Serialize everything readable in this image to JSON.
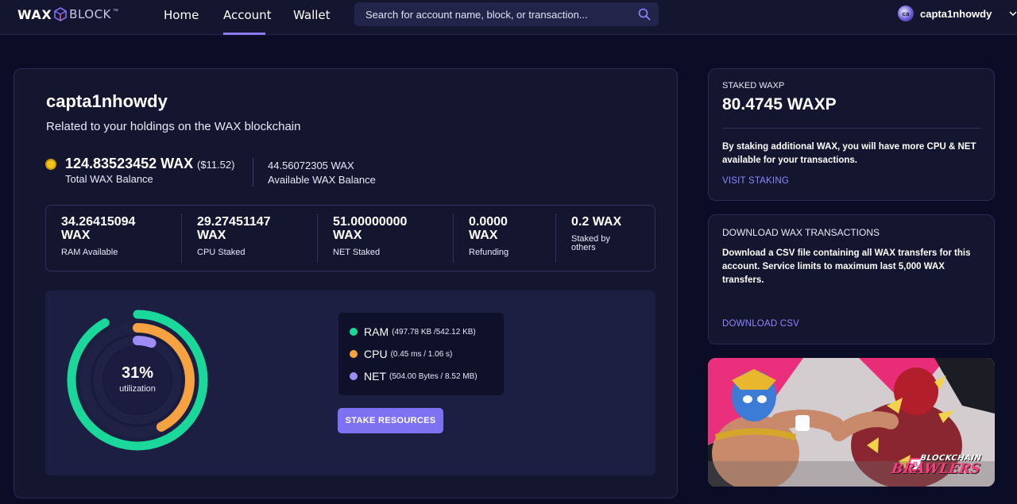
{
  "header": {
    "logo": {
      "part1": "WAX",
      "part2": "BLOCK",
      "tm": "™"
    },
    "nav": [
      {
        "label": "Home"
      },
      {
        "label": "Account"
      },
      {
        "label": "Wallet"
      }
    ],
    "search": {
      "placeholder": "Search for account name, block, or transaction..."
    },
    "user": {
      "avatar_initials": "ca",
      "name": "capta1nhowdy"
    }
  },
  "account": {
    "name": "capta1nhowdy",
    "subtitle": "Related to your holdings on the WAX blockchain",
    "total_amount": "124.83523452 WAX",
    "total_usd": "($11.52)",
    "total_label": "Total WAX Balance",
    "available_amount": "44.56072305 WAX",
    "available_label": "Available WAX Balance"
  },
  "stats": [
    {
      "value": "34.26415094 WAX",
      "label": "RAM Available"
    },
    {
      "value": "29.27451147 WAX",
      "label": "CPU Staked"
    },
    {
      "value": "51.00000000 WAX",
      "label": "NET Staked"
    },
    {
      "value": "0.0000 WAX",
      "label": "Refunding"
    },
    {
      "value": "0.2 WAX",
      "label": "Staked by others"
    }
  ],
  "utilization": {
    "percent_label": "31%",
    "caption": "utilization",
    "ram_fraction": 0.918,
    "cpu_fraction": 0.425,
    "net_fraction": 0.057,
    "legend": [
      {
        "name": "RAM",
        "detail": "(497.78 KB /542.12 KB)",
        "color": "#19d89a"
      },
      {
        "name": "CPU",
        "detail": "(0.45 ms / 1.06 s)",
        "color": "#f7a240"
      },
      {
        "name": "NET",
        "detail": "(504.00 Bytes / 8.52 MB)",
        "color": "#a08cf5"
      }
    ],
    "stake_button": "STAKE RESOURCES"
  },
  "staked_card": {
    "kicker": "STAKED WAXP",
    "amount": "80.4745 WAXP",
    "text": "By staking additional WAX, you will have more CPU & NET available for your transactions.",
    "link": "VISIT STAKING"
  },
  "download_card": {
    "kicker": "DOWNLOAD WAX TRANSACTIONS",
    "text": "Download a CSV file containing all WAX transfers for this account. Service limits to maximum last 5,000 WAX transfers.",
    "link": "DOWNLOAD CSV"
  },
  "promo": {
    "line1": "BLOCKCHAIN",
    "line2": "BRAWLERS",
    "badge": "B"
  },
  "colors": {
    "background": "#0b0c26",
    "card": "#14152f",
    "accent": "#7f72f2",
    "ram": "#19d89a",
    "cpu": "#f7a240",
    "net": "#a08cf5"
  }
}
